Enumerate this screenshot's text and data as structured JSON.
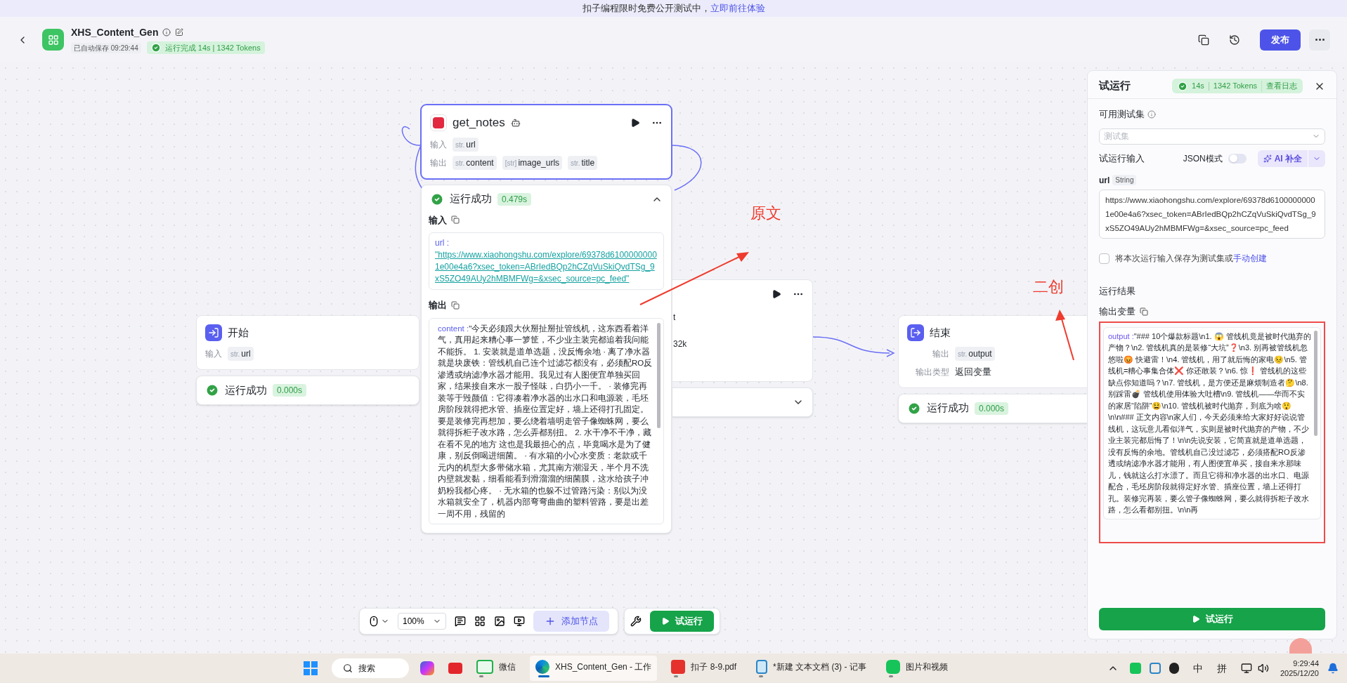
{
  "banner": {
    "text": "扣子编程限时免费公开测试中，",
    "link": "立即前往体验"
  },
  "header": {
    "title": "XHS_Content_Gen",
    "autosave": "已自动保存 09:29:44",
    "run_status": "运行完成 14s | 1342 Tokens",
    "publish": "发布"
  },
  "canvas": {
    "nodes": [
      {
        "kind": "start",
        "title": "开始",
        "selected": false,
        "rows": [
          {
            "label": "输入",
            "params": [
              {
                "type": "str.",
                "name": "url"
              }
            ]
          }
        ],
        "result": {
          "status": "运行成功",
          "time": "0.000s"
        }
      },
      {
        "kind": "plugin",
        "title": "get_notes",
        "selected": true,
        "rows": [
          {
            "label": "输入",
            "params": [
              {
                "type": "str.",
                "name": "url"
              }
            ]
          },
          {
            "label": "输出",
            "params": [
              {
                "type": "str.",
                "name": "content"
              },
              {
                "type": "[str]",
                "name": "image_urls"
              },
              {
                "type": "str.",
                "name": "title"
              }
            ]
          }
        ],
        "result": {
          "status": "运行成功",
          "time": "0.479s",
          "expanded": true,
          "input_label": "输入",
          "input": {
            "key": "url :",
            "value": "\"https://www.xiaohongshu.com/explore/69378d61000000001e00e4a6?xsec_token=ABrIedBQp2hCZqVuSkiQvdTSg_9xS5ZO49AUy2hMBMFWg=&xsec_source=pc_feed\""
          },
          "output_label": "输出",
          "output": {
            "key": "content :",
            "value": "\"今天必须跟大伙掰扯掰扯管线机，这东西看着洋气，真用起来糟心事一箩筐，不少业主装完都追着我问能不能拆。 1. 安装就是道单选题，没反悔余地 · 离了净水器就是块废铁：管线机自己连个过滤芯都没有，必须配RO反渗透或纳滤净水器才能用。我见过有人图便宜单独买回家，结果接自来水一股子怪味，白扔小一千。 · 装修完再装等于毁颜值：它得凑着净水器的出水口和电源装，毛坯房阶段就得把水管、插座位置定好，墙上还得打孔固定。要是装修完再想加，要么绕着墙明走管子像蜘蛛网，要么就得拆柜子改水路，怎么弄都别扭。 2. 水干净不干净，藏在看不见的地方 这也是我最担心的点，毕竟喝水是为了健康，别反倒喝进细菌。 · 有水箱的小心水变质：老款或千元内的机型大多带储水箱，尤其南方潮湿天，半个月不洗内壁就发黏，细看能看到滑溜溜的细菌膜，这水给孩子冲奶粉我都心疼。 · 无水箱的也躲不过管路污染：别以为没水箱就安全了，机器内部弯弯曲曲的塑料管路，要是出差一周不用，残留的"
          }
        }
      },
      {
        "kind": "node",
        "selected": false,
        "fragments": [
          "t",
          "32k"
        ],
        "result": {
          "expanded": false
        }
      },
      {
        "kind": "end",
        "title": "结束",
        "selected": false,
        "rows": [
          {
            "label": "输出",
            "params": [
              {
                "type": "str.",
                "name": "output"
              }
            ]
          },
          {
            "label": "输出类型",
            "value": "返回变量"
          }
        ],
        "result": {
          "status": "运行成功",
          "time": "0.000s"
        }
      }
    ],
    "annotations": [
      "原文",
      "二创"
    ]
  },
  "toolbar": {
    "zoom": "100%",
    "add_node": "添加节点",
    "run": "试运行"
  },
  "panel": {
    "title": "试运行",
    "time": "14s",
    "tokens": "1342 Tokens",
    "log": "查看日志",
    "test_set_label": "可用测试集",
    "test_set_placeholder": "测试集",
    "input_label": "试运行输入",
    "json_mode": {
      "label": "JSON模式",
      "on": false
    },
    "ai_button": "AI 补全",
    "field": {
      "name": "url",
      "type": "String",
      "value": "https://www.xiaohongshu.com/explore/69378d61000000001e00e4a6?xsec_token=ABrIedBQp2hCZqVuSkiQvdTSg_9xS5ZO49AUy2hMBMFWg=&xsec_source=pc_feed"
    },
    "save_option": {
      "checked": false,
      "text": "将本次运行输入保存为测试集或",
      "link": "手动创建"
    },
    "results_label": "运行结果",
    "output_label": "输出变量",
    "output": {
      "key": "output :",
      "value": "\"### 10个爆款标题\\n1. 😱 管线机竟是被时代抛弃的产物？\\n2. 管线机真的是装修“大坑”❓\\n3. 别再被管线机忽悠啦😡 快避雷！\\n4. 管线机，用了就后悔的家电😣\\n5. 管线机=糟心事集合体❌ 你还敢装？\\n6. 惊❗ 管线机的这些缺点你知道吗？\\n7. 管线机，是方便还是麻烦制造者🤔\\n8. 别踩雷💣 管线机使用体验大吐槽\\n9. 管线机——华而不实的家居“陷阱”😫\\n10. 管线机被时代抛弃，到底为啥😲\\n\\n### 正文内容\\n家人们，今天必须来给大家好好说说管线机，这玩意儿看似洋气，实则是被时代抛弃的产物，不少业主装完都后悔了！\\n\\n先说安装，它简直就是道单选题，没有反悔的余地。管线机自己没过滤芯，必须搭配RO反渗透或纳滤净水器才能用，有人图便宜单买，接自来水那味儿，钱就这么打水漂了。而且它得和净水器的出水口、电源配合，毛坯房阶段就得定好水管、插座位置，墙上还得打孔。装修完再装，要么管子像蜘蛛网，要么就得拆柜子改水路，怎么看都别扭。\\n\\n再"
    },
    "run_button": "试运行"
  },
  "taskbar": {
    "search": "搜索",
    "apps": [
      {
        "label": "微信",
        "active": false
      },
      {
        "label": "XHS_Content_Gen - 工作",
        "active": true
      },
      {
        "label": "扣子 8-9.pdf",
        "active": false
      },
      {
        "label": "*新建 文本文档 (3) - 记事",
        "active": false
      },
      {
        "label": "图片和视频",
        "active": false
      }
    ],
    "ime": [
      "中",
      "拼"
    ],
    "time": "9:29:44",
    "date": "2025/12/20"
  }
}
